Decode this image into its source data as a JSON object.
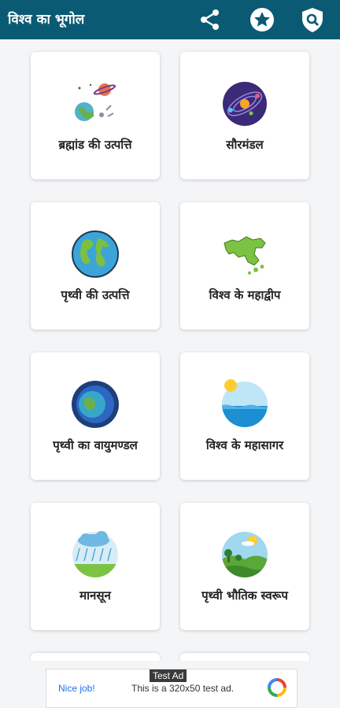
{
  "app_title": "विश्व का भूगोल",
  "toolbar": {
    "share_icon": "share-icon",
    "rate_icon": "star-badge-icon",
    "privacy_icon": "shield-search-icon"
  },
  "cards": [
    {
      "label": "ब्रह्मांड की उत्पत्ति",
      "icon": "planets-icon"
    },
    {
      "label": "सौरमंडल",
      "icon": "solar-system-icon"
    },
    {
      "label": "पृथ्वी की उत्पत्ति",
      "icon": "globe-icon"
    },
    {
      "label": "विश्व के महाद्वीप",
      "icon": "continent-map-icon"
    },
    {
      "label": "पृथ्वी का वायुमण्डल",
      "icon": "atmosphere-icon"
    },
    {
      "label": "विश्व के महासागर",
      "icon": "ocean-icon"
    },
    {
      "label": "मानसून",
      "icon": "rain-cloud-icon"
    },
    {
      "label": "पृथ्वी भौतिक स्वरूप",
      "icon": "landscape-icon"
    }
  ],
  "ad": {
    "tag": "Test Ad",
    "nice": "Nice job!",
    "message": "This is a 320x50 test ad."
  },
  "colors": {
    "appbar": "#0b5a74",
    "background": "#f4f5f7"
  }
}
